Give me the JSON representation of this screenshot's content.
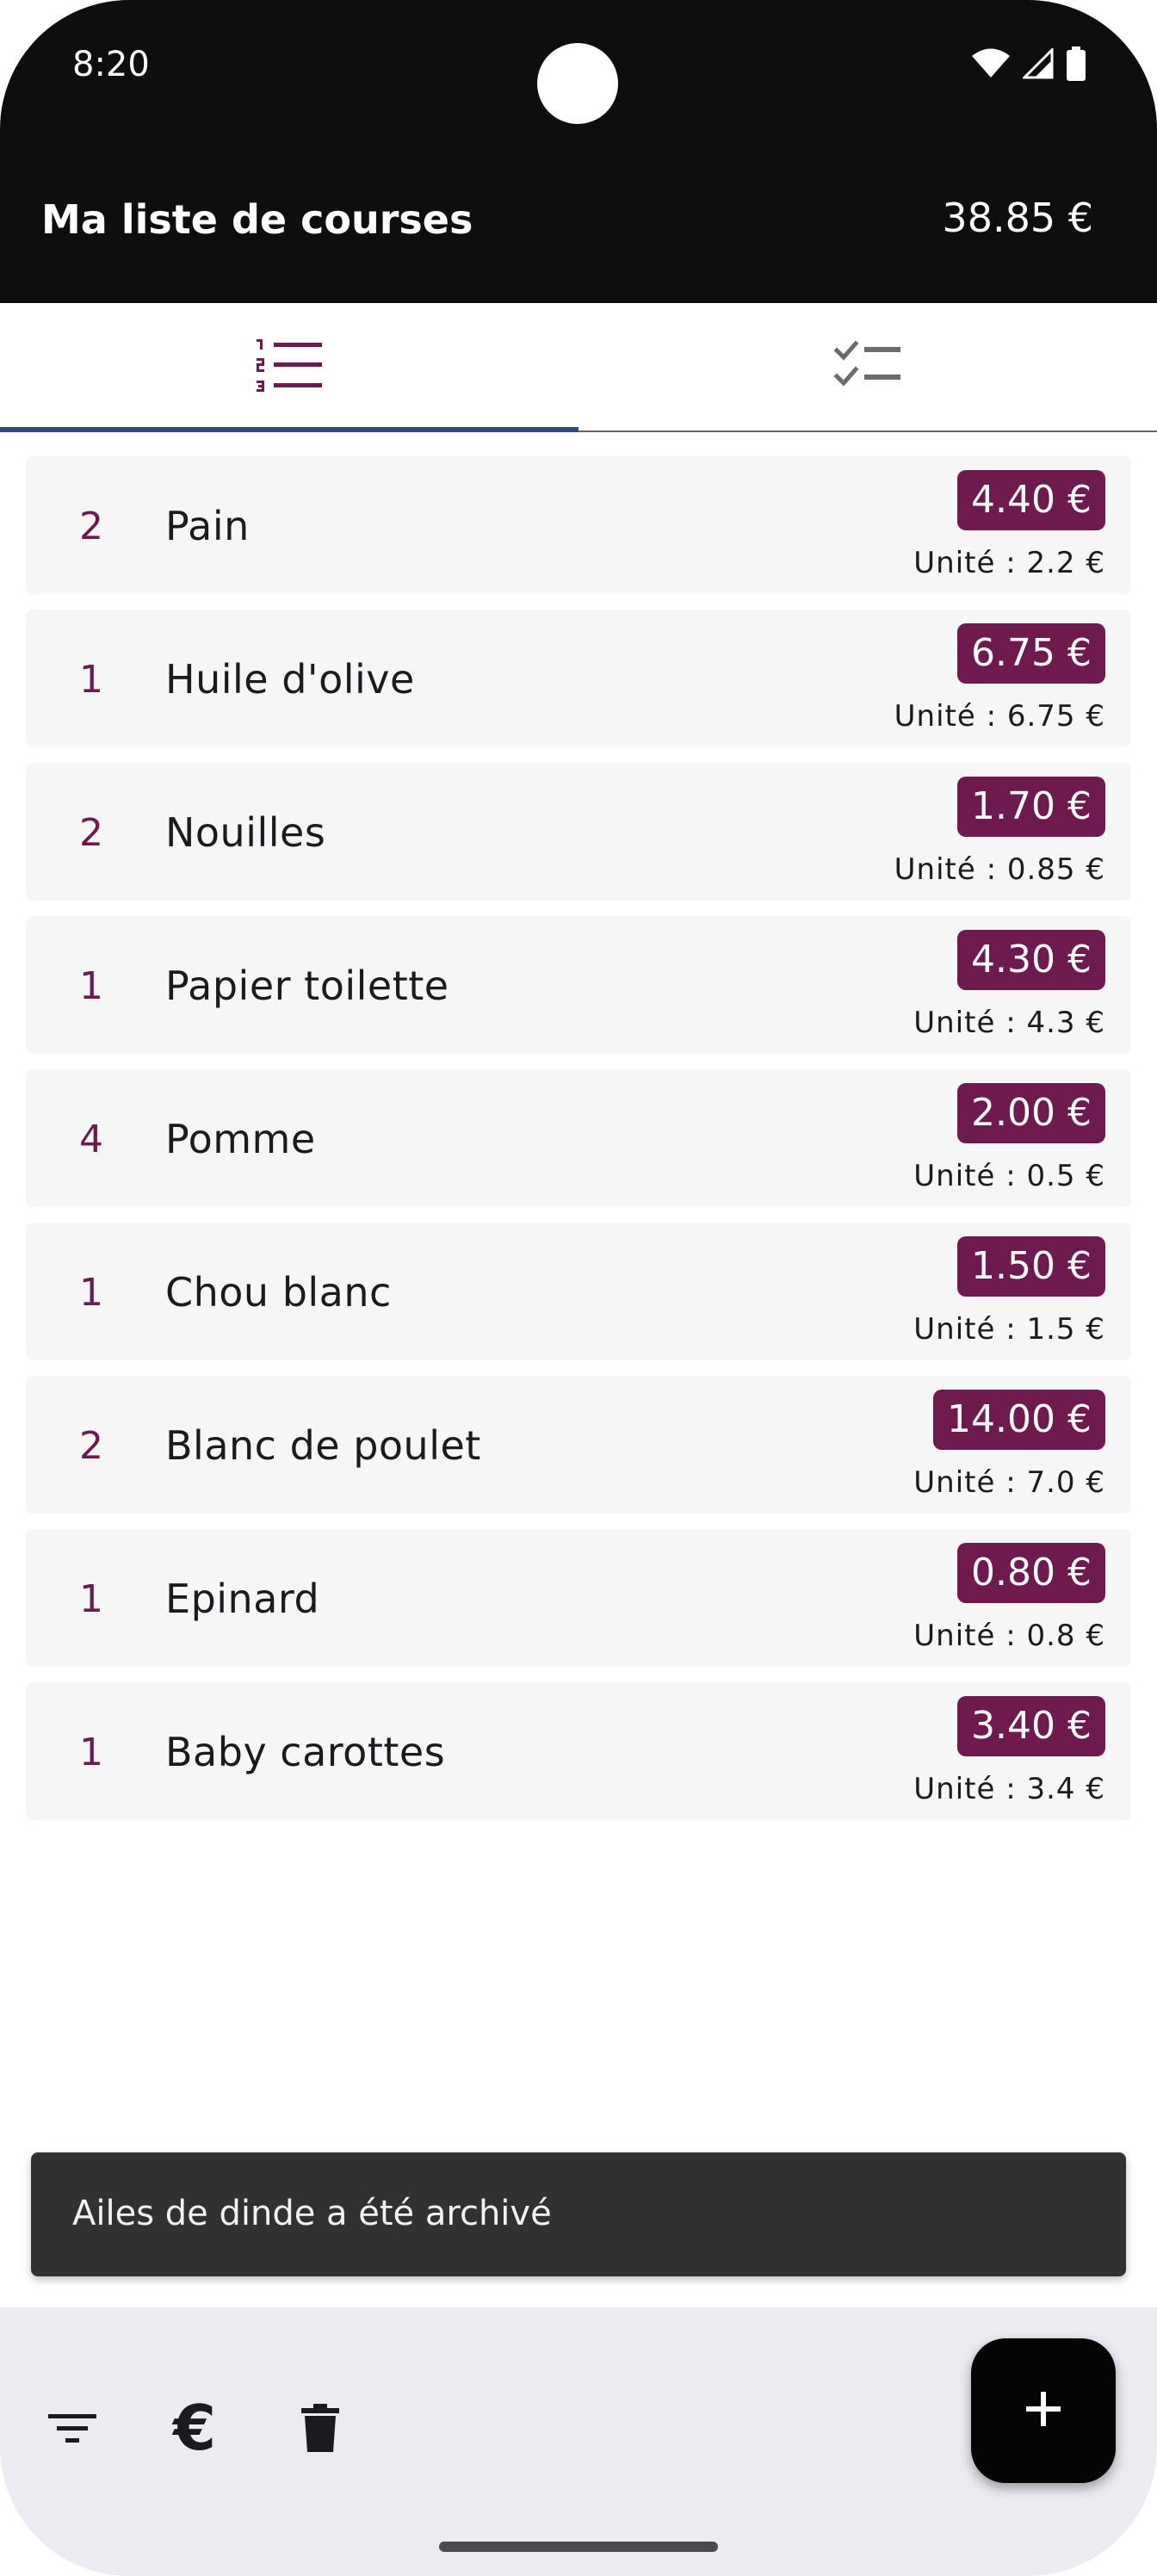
{
  "status_bar": {
    "time": "8:20",
    "icons": [
      "wifi-icon",
      "signal-icon",
      "battery-icon"
    ]
  },
  "app_bar": {
    "title": "Ma liste de courses",
    "total": "38.85 €"
  },
  "tabs": [
    {
      "icon": "numbered-list-icon",
      "active": true
    },
    {
      "icon": "checklist-icon",
      "active": false
    }
  ],
  "items": [
    {
      "qty": "2",
      "name": "Pain",
      "price": "4.40 €",
      "unit": "Unité : 2.2 €"
    },
    {
      "qty": "1",
      "name": "Huile d'olive",
      "price": "6.75 €",
      "unit": "Unité : 6.75 €"
    },
    {
      "qty": "2",
      "name": "Nouilles",
      "price": "1.70 €",
      "unit": "Unité : 0.85 €"
    },
    {
      "qty": "1",
      "name": "Papier toilette",
      "price": "4.30 €",
      "unit": "Unité : 4.3 €"
    },
    {
      "qty": "4",
      "name": "Pomme",
      "price": "2.00 €",
      "unit": "Unité : 0.5 €"
    },
    {
      "qty": "1",
      "name": "Chou blanc",
      "price": "1.50 €",
      "unit": "Unité : 1.5 €"
    },
    {
      "qty": "2",
      "name": "Blanc de poulet",
      "price": "14.00 €",
      "unit": "Unité : 7.0 €"
    },
    {
      "qty": "1",
      "name": "Epinard",
      "price": "0.80 €",
      "unit": "Unité : 0.8 €"
    },
    {
      "qty": "1",
      "name": "Baby carottes",
      "price": "3.40 €",
      "unit": "Unité : 3.4 €"
    }
  ],
  "snackbar": {
    "message": "Ailes de dinde a été archivé"
  },
  "bottom_bar": {
    "actions": [
      "filter-icon",
      "euro-icon",
      "delete-icon"
    ],
    "euro_glyph": "€",
    "fab_icon": "add-icon"
  },
  "colors": {
    "accent": "#6e1a4e",
    "tab_indicator": "#2d4a7a",
    "app_bar": "#0e0e0f",
    "bottom_bar": "#ecebf2"
  }
}
